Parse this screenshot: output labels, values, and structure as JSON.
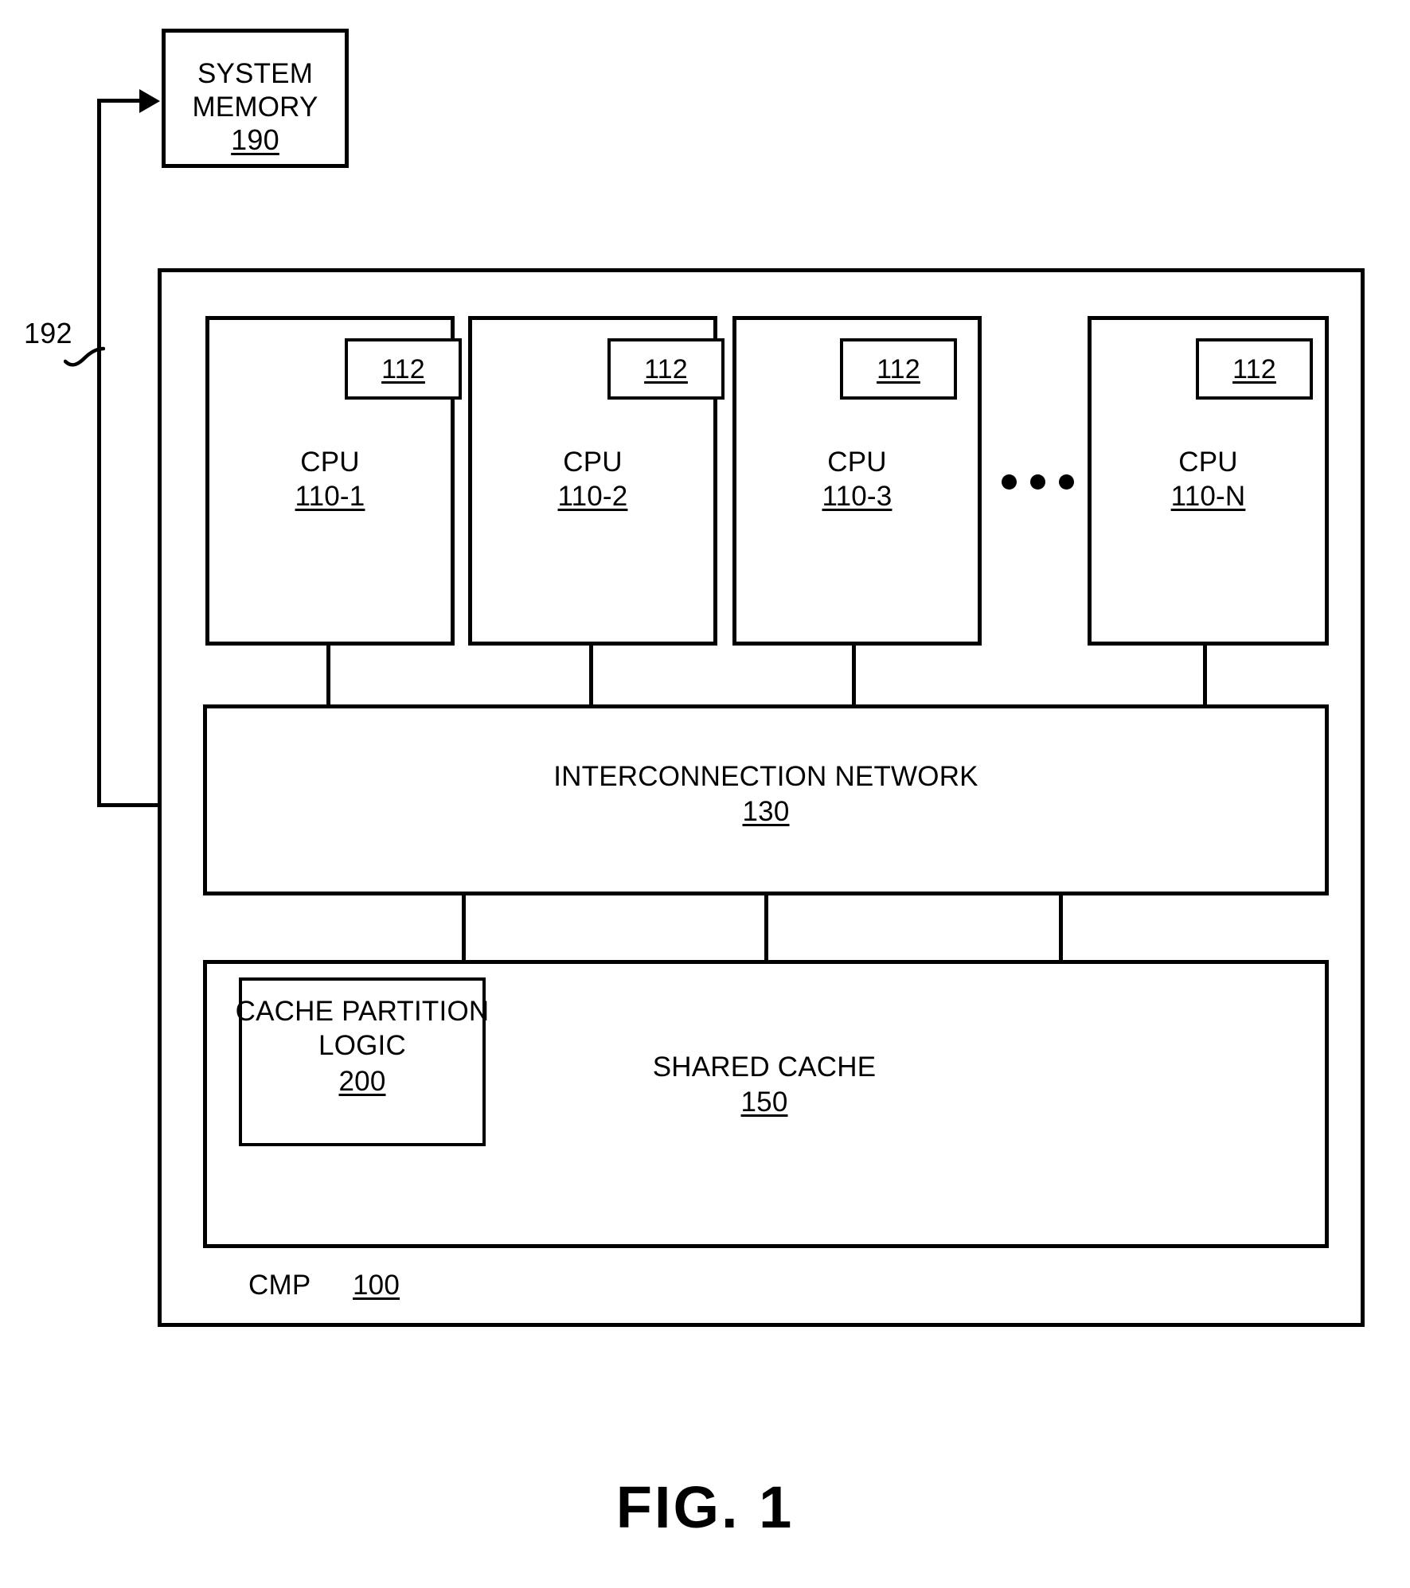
{
  "figure": {
    "caption": "FIG. 1",
    "reference_numerals": {
      "system_memory": "190",
      "bus": "192",
      "cmp": "100",
      "cpu_core": "112",
      "interconnection_network": "130",
      "shared_cache": "150",
      "cache_partition_logic": "200"
    }
  },
  "system_memory": {
    "line1": "SYSTEM",
    "line2": "MEMORY",
    "ref": "190"
  },
  "bus": {
    "ref": "192"
  },
  "cmp": {
    "label": "CMP",
    "ref": "100"
  },
  "cpus": [
    {
      "inner_ref": "112",
      "name": "CPU",
      "ref": "110-1"
    },
    {
      "inner_ref": "112",
      "name": "CPU",
      "ref": "110-2"
    },
    {
      "inner_ref": "112",
      "name": "CPU",
      "ref": "110-3"
    },
    {
      "inner_ref": "112",
      "name": "CPU",
      "ref": "110-N"
    }
  ],
  "ellipsis": "• • •",
  "interconnection_network": {
    "title": "INTERCONNECTION NETWORK",
    "ref": "130"
  },
  "shared_cache": {
    "title": "SHARED CACHE",
    "ref": "150"
  },
  "cache_partition_logic": {
    "line1": "CACHE PARTITION",
    "line2": "LOGIC",
    "ref": "200"
  },
  "colors": {
    "ink": "#000000",
    "paper": "#ffffff"
  }
}
